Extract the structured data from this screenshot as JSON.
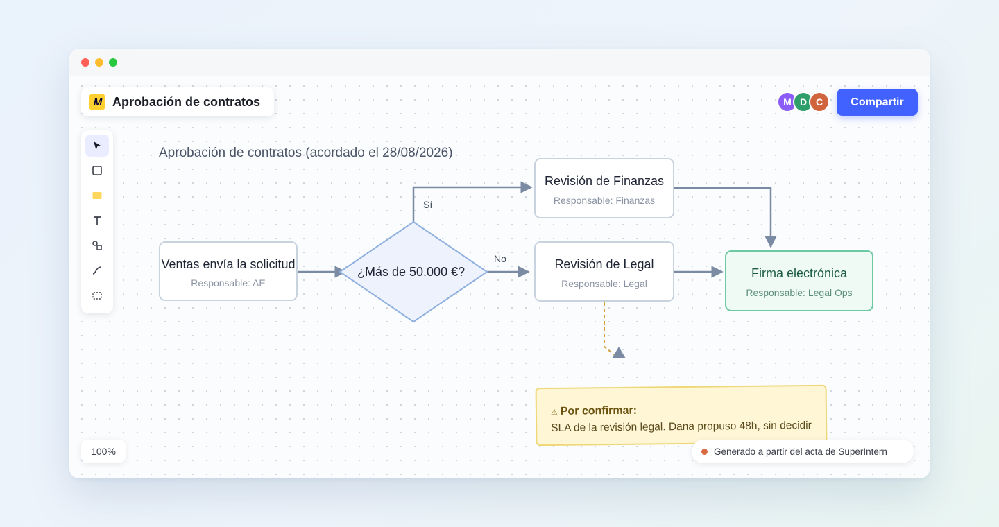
{
  "window": {
    "traffic_lights": [
      {
        "name": "close",
        "color": "#ff5f57"
      },
      {
        "name": "minimize",
        "color": "#febc2e"
      },
      {
        "name": "maximize",
        "color": "#28c840"
      }
    ]
  },
  "header": {
    "logo_icon": "miro-logo-icon",
    "logo_text": "M",
    "board_title": "Aprobación de contratos",
    "avatars": [
      {
        "initial": "M",
        "color": "#8b5cf6"
      },
      {
        "initial": "D",
        "color": "#2e9e6b"
      },
      {
        "initial": "C",
        "color": "#d0643d"
      }
    ],
    "share_label": "Compartir"
  },
  "toolbar": {
    "tools": [
      {
        "name": "select",
        "icon": "cursor-icon",
        "active": true
      },
      {
        "name": "shape",
        "icon": "square-icon",
        "active": false
      },
      {
        "name": "sticky-note",
        "icon": "sticky-note-icon",
        "active": false
      },
      {
        "name": "text",
        "icon": "text-icon",
        "active": false
      },
      {
        "name": "shapes",
        "icon": "shapes-icon",
        "active": false
      },
      {
        "name": "pen",
        "icon": "pen-icon",
        "active": false
      },
      {
        "name": "frame",
        "icon": "frame-icon",
        "active": false
      }
    ]
  },
  "diagram": {
    "title": "Aprobación de contratos (acordado el 28/08/2026)",
    "nodes": {
      "start": {
        "title": "Ventas envía la solicitud",
        "owner": "Responsable: AE"
      },
      "decision": {
        "label": "¿Más de 50.000 €?"
      },
      "finance": {
        "title": "Revisión de Finanzas",
        "owner": "Responsable: Finanzas"
      },
      "legal": {
        "title": "Revisión de Legal",
        "owner": "Responsable: Legal"
      },
      "sign": {
        "title": "Firma electrónica",
        "owner": "Responsable: Legal Ops"
      }
    },
    "edge_labels": {
      "yes": "Sí",
      "no": "No"
    },
    "note": {
      "icon": "warning-icon",
      "icon_glyph": "⚠",
      "heading": "Por confirmar:",
      "body": "SLA de la revisión legal. Dana propuso 48h, sin decidir"
    },
    "colors": {
      "edge": "#7a8ba3",
      "decision_fill": "#edf2fd",
      "decision_stroke": "#8fb0df",
      "note_dash": "#d6a33a",
      "success_border": "#6cc9a1"
    }
  },
  "footer": {
    "zoom": "100%",
    "source_note": "Generado a partir del acta de SuperIntern",
    "source_dot_color": "#d96a43"
  }
}
